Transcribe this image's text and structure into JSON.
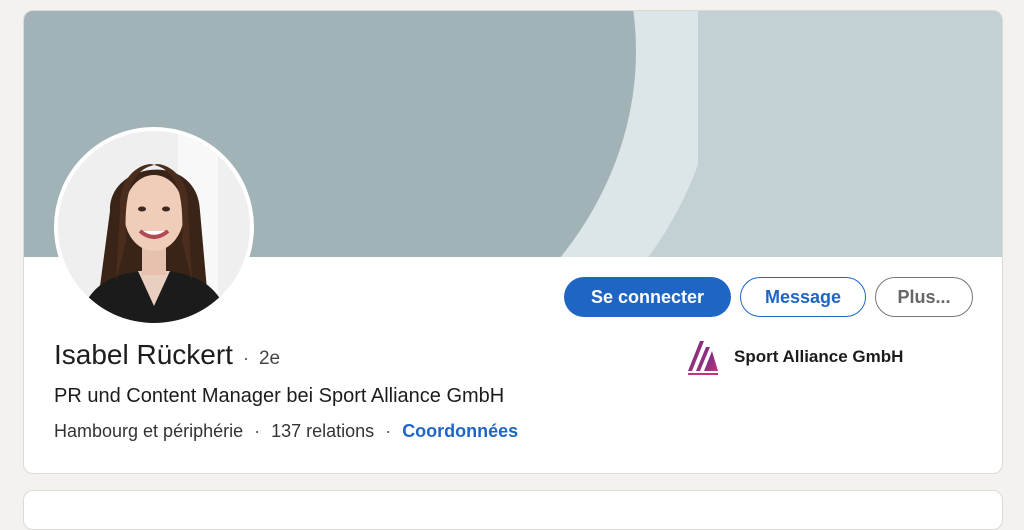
{
  "profile": {
    "name": "Isabel Rückert",
    "separator": "·",
    "degree": "2e",
    "headline": "PR und Content Manager bei Sport Alliance GmbH",
    "location": "Hambourg et périphérie",
    "relations": "137 relations",
    "contact_link": "Coordonnées",
    "meta_separator": "·"
  },
  "actions": {
    "connect_label": "Se connecter",
    "message_label": "Message",
    "more_label": "Plus..."
  },
  "company": {
    "name": "Sport Alliance GmbH",
    "logo_icon": "sport-alliance-logo-icon"
  },
  "colors": {
    "primary_blue": "#1f66c4",
    "banner_dark": "#a2b3b7",
    "banner_light": "#c3d0d4",
    "background": "#f3f2ef"
  }
}
